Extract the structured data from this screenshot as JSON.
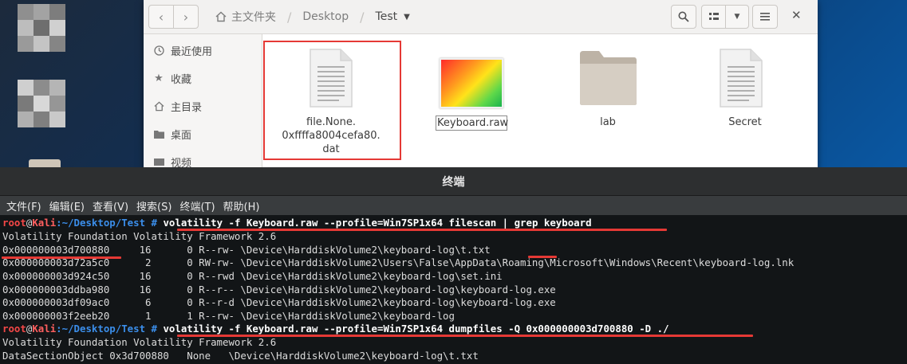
{
  "file_manager": {
    "breadcrumb": [
      "主文件夹",
      "Desktop",
      "Test"
    ],
    "sidebar": [
      {
        "label": "最近使用",
        "icon": "clock-icon"
      },
      {
        "label": "收藏",
        "icon": "star-icon"
      },
      {
        "label": "主目录",
        "icon": "home-icon"
      },
      {
        "label": "桌面",
        "icon": "folder-icon"
      },
      {
        "label": "视频",
        "icon": "video-icon"
      }
    ],
    "files": [
      {
        "label": [
          "file.None.",
          "0xffffa8004cefa80.",
          "dat"
        ],
        "type": "document",
        "selected": true
      },
      {
        "label": [
          "Keyboard.raw"
        ],
        "type": "image"
      },
      {
        "label": [
          "lab"
        ],
        "type": "folder"
      },
      {
        "label": [
          "Secret"
        ],
        "type": "document"
      }
    ]
  },
  "terminal": {
    "title": "终端",
    "menu": [
      "文件(F)",
      "编辑(E)",
      "查看(V)",
      "搜索(S)",
      "终端(T)",
      "帮助(H)"
    ],
    "prompt": {
      "user": "root",
      "at": "@",
      "host": "Kali",
      "path": ":~/Desktop/Test",
      "symbol": " #"
    },
    "cmd1": " volatility -f Keyboard.raw --profile=Win7SP1x64 filescan | grep keyboard",
    "cmd2": " volatility -f Keyboard.raw --profile=Win7SP1x64 dumpfiles -Q 0x000000003d700880 -D ./",
    "banner": "Volatility Foundation Volatility Framework 2.6",
    "scan_rows": [
      "0x000000003d700880     16      0 R--rw- \\Device\\HarddiskVolume2\\keyboard-log\\t.txt",
      "0x000000003d72a5c0      2      0 RW-rw- \\Device\\HarddiskVolume2\\Users\\False\\AppData\\Roaming\\Microsoft\\Windows\\Recent\\keyboard-log.lnk",
      "0x000000003d924c50     16      0 R--rwd \\Device\\HarddiskVolume2\\keyboard-log\\set.ini",
      "0x000000003ddba980     16      0 R--r-- \\Device\\HarddiskVolume2\\keyboard-log\\keyboard-log.exe",
      "0x000000003df09ac0      6      0 R--r-d \\Device\\HarddiskVolume2\\keyboard-log\\keyboard-log.exe",
      "0x000000003f2eeb20      1      1 R--rw- \\Device\\HarddiskVolume2\\keyboard-log"
    ],
    "dump_line": "DataSectionObject 0x3d700880   None   \\Device\\HarddiskVolume2\\keyboard-log\\t.txt"
  },
  "colors": {
    "highlight": "#e53935",
    "prompt_path": "#3b8eea",
    "prompt_user": "#f44747"
  }
}
